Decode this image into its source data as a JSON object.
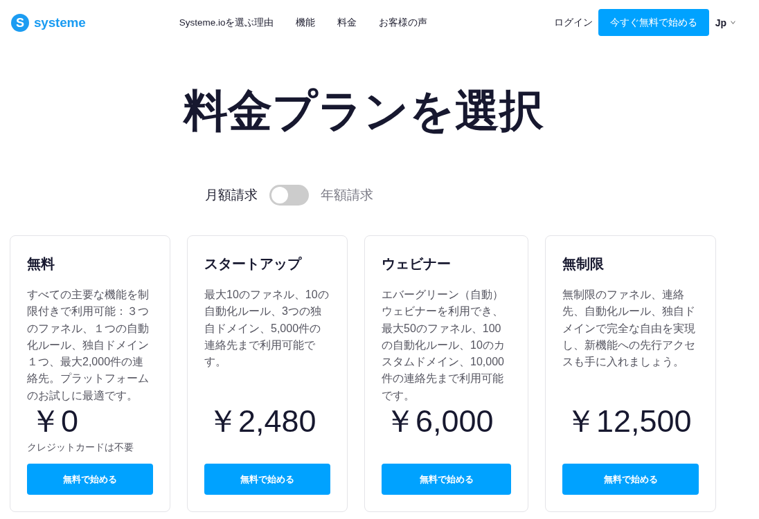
{
  "header": {
    "logo": {
      "mark": "S",
      "text": "systeme"
    },
    "nav": [
      {
        "label": "Systeme.ioを選ぶ理由"
      },
      {
        "label": "機能"
      },
      {
        "label": "料金"
      },
      {
        "label": "お客様の声"
      }
    ],
    "login": "ログイン",
    "cta": "今すぐ無料で始める",
    "language": "Jp"
  },
  "title": "料金プランを選択",
  "billing": {
    "monthly_label": "月額請求",
    "annual_label": "年額請求",
    "on": false
  },
  "plans": [
    {
      "name": "無料",
      "description": "すべての主要な機能を制限付きで利用可能：３つのファネル、１つの自動化ルール、独自ドメイン１つ、最大2,000件の連絡先。プラットフォームのお試しに最適です。",
      "price": "￥0",
      "note": "クレジットカードは不要",
      "button": "無料で始める"
    },
    {
      "name": "スタートアップ",
      "description": "最大10のファネル、10の自動化ルール、3つの独自ドメイン、5,000件の連絡先まで利用可能です。",
      "price": "￥2,480",
      "button": "無料で始める"
    },
    {
      "name": "ウェビナー",
      "description": "エバーグリーン（自動）ウェビナーを利用でき、最大50のファネル、100の自動化ルール、10のカスタムドメイン、10,000件の連絡先まで利用可能です。",
      "price": "￥6,000",
      "button": "無料で始める"
    },
    {
      "name": "無制限",
      "description": "無制限のファネル、連絡先、自動化ルール、独自ドメインで完全な自由を実現し、新機能への先行アクセスも手に入れましょう。",
      "price": "￥12,500",
      "button": "無料で始める"
    }
  ]
}
